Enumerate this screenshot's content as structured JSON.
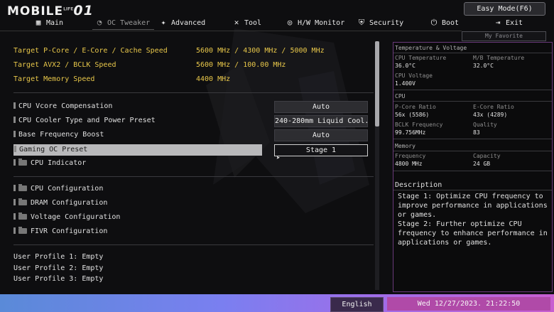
{
  "header": {
    "logo_text": "MOBILE",
    "logo_super": "LIFE",
    "logo_suffix": "01",
    "easy_mode": "Easy Mode(F6)",
    "my_favorite": "My Favorite"
  },
  "nav": [
    {
      "label": "Main",
      "icon": "grid-icon"
    },
    {
      "label": "OC Tweaker",
      "icon": "gauge-icon"
    },
    {
      "label": "Advanced",
      "icon": "star-icon"
    },
    {
      "label": "Tool",
      "icon": "tools-icon"
    },
    {
      "label": "H/W Monitor",
      "icon": "monitor-icon"
    },
    {
      "label": "Security",
      "icon": "shield-icon"
    },
    {
      "label": "Boot",
      "icon": "power-icon"
    },
    {
      "label": "Exit",
      "icon": "exit-icon"
    }
  ],
  "targets": [
    {
      "label": "Target P-Core / E-Core / Cache Speed",
      "value": "5600 MHz / 4300 MHz / 5000 MHz"
    },
    {
      "label": "Target AVX2 / BCLK Speed",
      "value": "5600 MHz / 100.00 MHz"
    },
    {
      "label": "Target Memory Speed",
      "value": "4400 MHz"
    }
  ],
  "settings": [
    {
      "label": "CPU Vcore Compensation",
      "value": "Auto"
    },
    {
      "label": "CPU Cooler Type and Power Preset",
      "value": "240-280mm Liquid Cool..."
    },
    {
      "label": "Base Frequency Boost",
      "value": "Auto"
    },
    {
      "label": "Gaming OC Preset",
      "value": "Stage 1"
    }
  ],
  "cpu_indicator": "CPU Indicator",
  "submenus": [
    "CPU Configuration",
    "DRAM Configuration",
    "Voltage Configuration",
    "FIVR Configuration"
  ],
  "profiles": [
    "User Profile 1: Empty",
    "User Profile 2: Empty",
    "User Profile 3: Empty"
  ],
  "panel": {
    "tv_title": "Temperature & Voltage",
    "cpu_temp_label": "CPU Temperature",
    "cpu_temp": "36.0°C",
    "mb_temp_label": "M/B Temperature",
    "mb_temp": "32.0°C",
    "cpu_volt_label": "CPU Voltage",
    "cpu_volt": "1.400V",
    "cpu_title": "CPU",
    "pcore_label": "P-Core Ratio",
    "pcore": "56x (5586)",
    "ecore_label": "E-Core Ratio",
    "ecore": "43x (4289)",
    "bclk_label": "BCLK Frequency",
    "bclk": "99.756MHz",
    "quality_label": "Quality",
    "quality": "83",
    "mem_title": "Memory",
    "freq_label": "Frequency",
    "freq": "4800 MHz",
    "cap_label": "Capacity",
    "cap": "24 GB",
    "desc_title": "Description",
    "desc_text": "Stage 1: Optimize CPU frequency to improve performance in applications or games.\nStage 2: Further optimize CPU frequency to enhance performance in applications or games."
  },
  "footer": {
    "language": "English",
    "datetime": "Wed 12/27/2023. 21:22:50"
  },
  "colors": {
    "accent": "#e8c74a",
    "bottom_gradient": "#7a7ff0",
    "panel_border": "#6a3a7a"
  }
}
